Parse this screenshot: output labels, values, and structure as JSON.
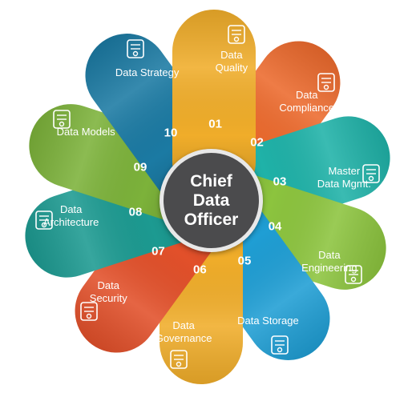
{
  "hub": {
    "line1": "Chief",
    "line2": "Data",
    "line3": "Officer"
  },
  "segments": [
    {
      "num": "01",
      "label": "Data\nQuality",
      "icon": "certificate-icon",
      "color": "#f0ad2a"
    },
    {
      "num": "02",
      "label": "Data\nCompliance",
      "icon": "document-check-icon",
      "color": "#ec6a2d"
    },
    {
      "num": "03",
      "label": "Master\nData Mgmt.",
      "icon": "database-search-icon",
      "color": "#1fb2a8"
    },
    {
      "num": "04",
      "label": "Data\nEngineering",
      "icon": "gear-network-icon",
      "color": "#8cc43e"
    },
    {
      "num": "05",
      "label": "Data Storage",
      "icon": "folder-storage-icon",
      "color": "#1f9ed4"
    },
    {
      "num": "06",
      "label": "Data\nGovernance",
      "icon": "settings-window-icon",
      "color": "#f0ad2a"
    },
    {
      "num": "07",
      "label": "Data\nSecurity",
      "icon": "secure-document-icon",
      "color": "#e2502a"
    },
    {
      "num": "08",
      "label": "Data\nArchitecture",
      "icon": "server-network-icon",
      "color": "#1c9a91"
    },
    {
      "num": "09",
      "label": "Data Models",
      "icon": "database-users-icon",
      "color": "#7cb23a"
    },
    {
      "num": "10",
      "label": "Data Strategy",
      "icon": "chart-search-icon",
      "color": "#1b7aa3"
    }
  ]
}
